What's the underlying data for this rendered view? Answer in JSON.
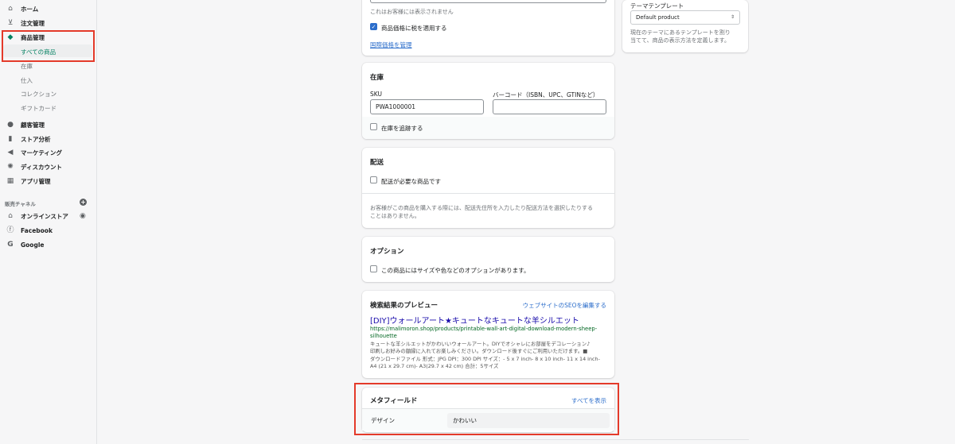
{
  "sidebar": {
    "items": [
      {
        "icon": "home-icon",
        "label": "ホーム"
      },
      {
        "icon": "order-icon",
        "label": "注文管理"
      },
      {
        "icon": "tag-icon",
        "label": "商品管理"
      },
      {
        "icon": "customer-icon",
        "label": "顧客管理"
      },
      {
        "icon": "analytics-icon",
        "label": "ストア分析"
      },
      {
        "icon": "marketing-icon",
        "label": "マーケティング"
      },
      {
        "icon": "discount-icon",
        "label": "ディスカウント"
      },
      {
        "icon": "apps-icon",
        "label": "アプリ管理"
      }
    ],
    "product_sub": [
      "すべての商品",
      "在庫",
      "仕入",
      "コレクション",
      "ギフトカード"
    ],
    "channels_title": "販売チャネル",
    "channels": [
      {
        "icon": "store-icon",
        "label": "オンラインストア"
      },
      {
        "icon": "facebook-icon",
        "label": "Facebook"
      },
      {
        "icon": "google-icon",
        "label": "Google"
      }
    ]
  },
  "pricing": {
    "hidden_note": "これはお客様には表示されません",
    "tax_label": "商品価格に税を適用する",
    "intl_link": "国際価格を管理"
  },
  "inventory": {
    "title": "在庫",
    "sku_label": "SKU",
    "sku_value": "PWA1000001",
    "barcode_label": "バーコード（ISBN、UPC、GTINなど）",
    "barcode_value": "",
    "track_label": "在庫を追跡する"
  },
  "shipping": {
    "title": "配送",
    "required_label": "配送が必要な商品です",
    "note_line1": "お客様がこの商品を購入する際には、配送先住所を入力したり配送方法を選択したりする",
    "note_line2": "ことはありません。"
  },
  "options": {
    "title": "オプション",
    "label": "この商品にはサイズや色などのオプションがあります。"
  },
  "seo": {
    "title": "検索結果のプレビュー",
    "edit_link": "ウェブサイトのSEOを編集する",
    "page_title": "[DIY]ウォールアート★キュートなキュートな羊シルエット",
    "url_line1": "https://malimoron.shop/products/printable-wall-art-digital-download-modern-sheep-",
    "url_line2": "silhouette",
    "desc_line1": "キュートな羊シルエットがかわいいウォールアート。DIYでオシャレにお部屋をデコレーション♪",
    "desc_line2": "印刷しお好みの額縁に入れてお楽しみください。ダウンロード後すぐにご利用いただけます。■",
    "desc_line3": "ダウンロードファイル 形式：JPG DPI：300 DPI サイズ：- 5 x 7 inch- 8 x 10 inch- 11 x 14 inch-",
    "desc_line4": "A4 (21 x 29.7 cm)- A3(29.7 x 42 cm) 合計：5サイズ"
  },
  "metafields": {
    "title": "メタフィールド",
    "show_all": "すべてを表示",
    "row_label": "デザイン",
    "row_value": "かわいい"
  },
  "theme": {
    "title": "テーマテンプレート",
    "selected": "Default product",
    "desc_line1": "現在のテーマにあるテンプレートを割り",
    "desc_line2": "当てて、商品の表示方法を定義します。"
  },
  "colors": {
    "accent": "#2c6ecb",
    "active_nav": "#008060",
    "highlight": "#e43a2a"
  }
}
